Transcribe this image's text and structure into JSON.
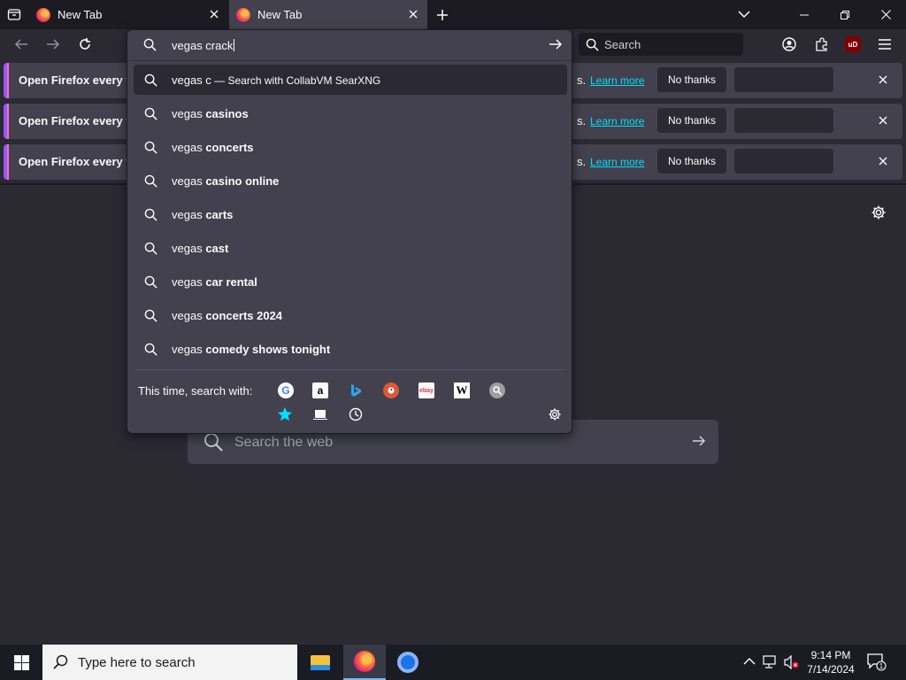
{
  "tabs": [
    {
      "title": "New Tab",
      "active": false
    },
    {
      "title": "New Tab",
      "active": true
    }
  ],
  "toolbar": {
    "search_placeholder": "Search",
    "ublock_label": "uD"
  },
  "notifications": [
    {
      "message": "Open Firefox every ti",
      "tail": "s.",
      "learn_more": "Learn more",
      "no_thanks": "No thanks"
    },
    {
      "message": "Open Firefox every ti",
      "tail": "s.",
      "learn_more": "Learn more",
      "no_thanks": "No thanks"
    },
    {
      "message": "Open Firefox every ti",
      "tail": "s.",
      "learn_more": "Learn more",
      "no_thanks": "No thanks"
    }
  ],
  "urlbar": {
    "value": "vegas crack",
    "suggestions": [
      {
        "prefix": "vegas c",
        "suffix": "",
        "sub": " — Search with CollabVM SearXNG",
        "selected": true
      },
      {
        "prefix": "vegas ",
        "suffix": "casinos",
        "sub": "",
        "selected": false
      },
      {
        "prefix": "vegas ",
        "suffix": "concerts",
        "sub": "",
        "selected": false
      },
      {
        "prefix": "vegas ",
        "suffix": "casino online",
        "sub": "",
        "selected": false
      },
      {
        "prefix": "vegas ",
        "suffix": "carts",
        "sub": "",
        "selected": false
      },
      {
        "prefix": "vegas ",
        "suffix": "cast",
        "sub": "",
        "selected": false
      },
      {
        "prefix": "vegas ",
        "suffix": "car rental",
        "sub": "",
        "selected": false
      },
      {
        "prefix": "vegas ",
        "suffix": "concerts 2024",
        "sub": "",
        "selected": false
      },
      {
        "prefix": "vegas ",
        "suffix": "comedy shows tonight",
        "sub": "",
        "selected": false
      }
    ],
    "oneoff_label": "This time, search with:",
    "engines": [
      "google-icon",
      "amazon-icon",
      "bing-icon",
      "duckduckgo-icon",
      "ebay-icon",
      "wikipedia-icon",
      "searxng-icon",
      "bookmarks-icon",
      "tabs-icon",
      "history-icon"
    ],
    "engine_glyphs": {
      "google": "G",
      "amazon": "a",
      "ebay": "ebay",
      "wiki": "W"
    }
  },
  "newtab": {
    "search_placeholder": "Search the web"
  },
  "taskbar": {
    "search_placeholder": "Type here to search",
    "time": "9:14 PM",
    "date": "7/14/2024",
    "notification_count": "1"
  },
  "colors": {
    "accent": "#00ddff",
    "frame": "#1c1b22",
    "toolbar": "#2b2a33",
    "panel": "#42414d"
  }
}
